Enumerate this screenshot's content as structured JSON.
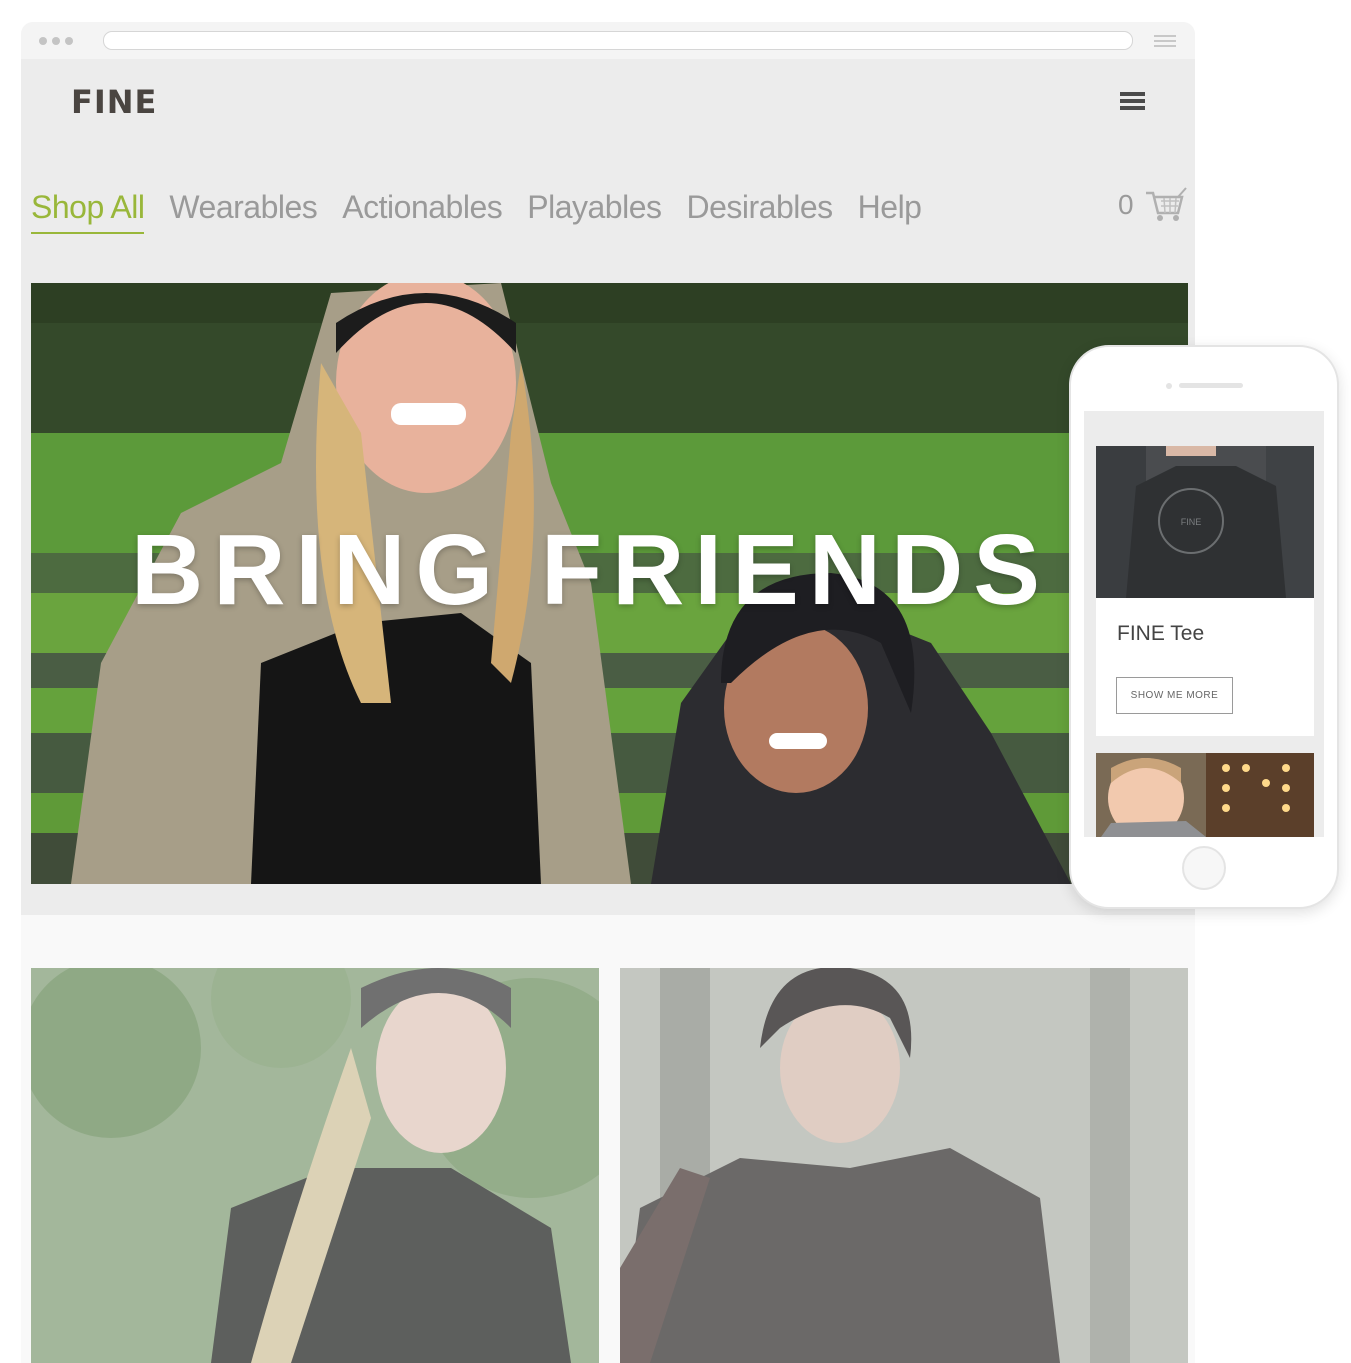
{
  "site": {
    "logo": "FINE"
  },
  "nav": {
    "items": [
      {
        "label": "Shop All",
        "active": true
      },
      {
        "label": "Wearables",
        "active": false
      },
      {
        "label": "Actionables",
        "active": false
      },
      {
        "label": "Playables",
        "active": false
      },
      {
        "label": "Desirables",
        "active": false
      },
      {
        "label": "Help",
        "active": false
      }
    ],
    "cart_count": "0"
  },
  "hero": {
    "title": "BRING FRIENDS"
  },
  "mobile": {
    "product_title": "FINE Tee",
    "button_label": "SHOW ME MORE"
  },
  "colors": {
    "accent": "#99b73a",
    "nav_text": "#9a9a9a",
    "background": "#ececec"
  }
}
